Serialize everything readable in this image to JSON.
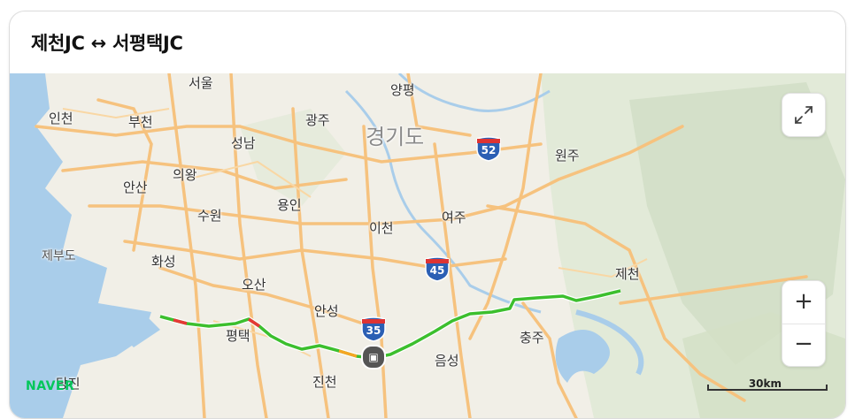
{
  "title": "제천JC ↔ 서평택JC",
  "map": {
    "region_label": "경기도",
    "places": [
      {
        "name": "인천",
        "kind": "city"
      },
      {
        "name": "부천",
        "kind": "city"
      },
      {
        "name": "서울",
        "kind": "city"
      },
      {
        "name": "양평",
        "kind": "city"
      },
      {
        "name": "광주",
        "kind": "city"
      },
      {
        "name": "성남",
        "kind": "city"
      },
      {
        "name": "의왕",
        "kind": "city"
      },
      {
        "name": "안산",
        "kind": "city"
      },
      {
        "name": "수원",
        "kind": "city"
      },
      {
        "name": "용인",
        "kind": "city"
      },
      {
        "name": "이천",
        "kind": "city"
      },
      {
        "name": "여주",
        "kind": "city"
      },
      {
        "name": "원주",
        "kind": "city"
      },
      {
        "name": "제부도",
        "kind": "island"
      },
      {
        "name": "화성",
        "kind": "city"
      },
      {
        "name": "오산",
        "kind": "city"
      },
      {
        "name": "안성",
        "kind": "city"
      },
      {
        "name": "평택",
        "kind": "city"
      },
      {
        "name": "제천",
        "kind": "city"
      },
      {
        "name": "충주",
        "kind": "city"
      },
      {
        "name": "음성",
        "kind": "city"
      },
      {
        "name": "진천",
        "kind": "city"
      },
      {
        "name": "당진",
        "kind": "city"
      }
    ],
    "highway_shields": [
      "52",
      "45",
      "35"
    ],
    "route_color": "#3cbf2e",
    "congestion_colors": [
      "#e53935",
      "#f5a623"
    ],
    "water_color": "#a9cdea",
    "road_color": "#f6c27e",
    "brand": "NAVER",
    "scale_label": "30km",
    "controls": {
      "expand_icon": "expand-icon",
      "zoom_in": "+",
      "zoom_out": "−"
    }
  }
}
